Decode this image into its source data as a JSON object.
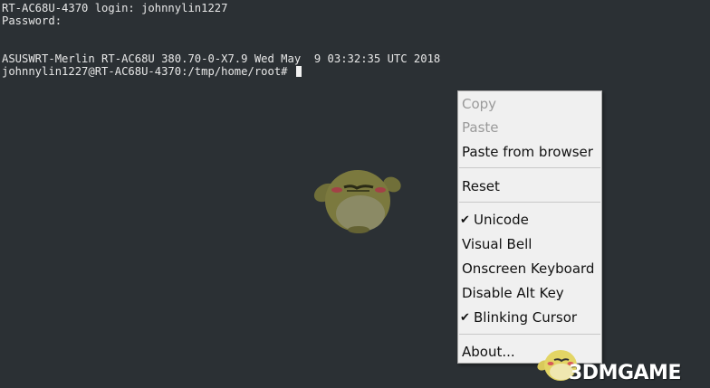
{
  "terminal": {
    "lines": [
      "RT-AC68U-4370 login: johnnylin1227",
      "Password:",
      "",
      "",
      "ASUSWRT-Merlin RT-AC68U 380.70-0-X7.9 Wed May  9 03:32:35 UTC 2018",
      "johnnylin1227@RT-AC68U-4370:/tmp/home/root# "
    ]
  },
  "context_menu": {
    "copy": "Copy",
    "paste": "Paste",
    "paste_from_browser": "Paste from browser",
    "reset": "Reset",
    "unicode": "Unicode",
    "visual_bell": "Visual Bell",
    "onscreen_keyboard": "Onscreen Keyboard",
    "disable_alt_key": "Disable Alt Key",
    "blinking_cursor": "Blinking Cursor",
    "about": "About...",
    "check_mark": "✔"
  },
  "watermark": {
    "text": "3DMGAME"
  }
}
